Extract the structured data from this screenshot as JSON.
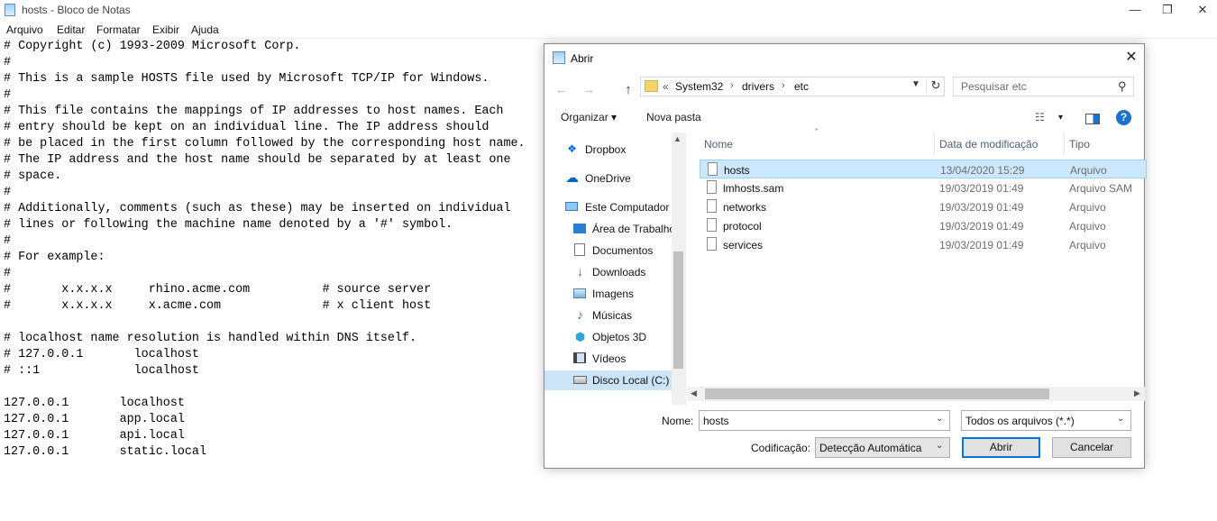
{
  "notepad": {
    "title": "hosts - Bloco de Notas",
    "window_controls": {
      "minimize": "—",
      "maximize": "❐",
      "close": "✕"
    },
    "menu": [
      "Arquivo",
      "Editar",
      "Formatar",
      "Exibir",
      "Ajuda"
    ],
    "content": "# Copyright (c) 1993-2009 Microsoft Corp.\n#\n# This is a sample HOSTS file used by Microsoft TCP/IP for Windows.\n#\n# This file contains the mappings of IP addresses to host names. Each\n# entry should be kept on an individual line. The IP address should\n# be placed in the first column followed by the corresponding host name.\n# The IP address and the host name should be separated by at least one\n# space.\n#\n# Additionally, comments (such as these) may be inserted on individual\n# lines or following the machine name denoted by a '#' symbol.\n#\n# For example:\n#\n#       x.x.x.x     rhino.acme.com          # source server\n#       x.x.x.x     x.acme.com              # x client host\n\n# localhost name resolution is handled within DNS itself.\n# 127.0.0.1       localhost\n# ::1             localhost\n\n127.0.0.1       localhost\n127.0.0.1       app.local\n127.0.0.1       api.local\n127.0.0.1       static.local"
  },
  "dialog": {
    "title": "Abrir",
    "close": "✕",
    "nav": {
      "back": "←",
      "forward": "→",
      "up": "↑"
    },
    "breadcrumb": {
      "prefix": "«",
      "parts": [
        "System32",
        "drivers",
        "etc"
      ],
      "sep": "›"
    },
    "search_placeholder": "Pesquisar etc",
    "toolbar": {
      "organize": "Organizar ▾",
      "new_folder": "Nova pasta",
      "view": "▾",
      "help": "?"
    },
    "sidebar": [
      {
        "label": "Dropbox",
        "icon": "dropbox-icon"
      },
      {
        "label": "OneDrive",
        "icon": "onedrive-icon"
      },
      {
        "label": "Este Computador",
        "icon": "computer-icon"
      },
      {
        "label": "Área de Trabalho",
        "icon": "desktop-icon"
      },
      {
        "label": "Documentos",
        "icon": "documents-icon"
      },
      {
        "label": "Downloads",
        "icon": "downloads-icon"
      },
      {
        "label": "Imagens",
        "icon": "pictures-icon"
      },
      {
        "label": "Músicas",
        "icon": "music-icon"
      },
      {
        "label": "Objetos 3D",
        "icon": "objects-3d-icon"
      },
      {
        "label": "Vídeos",
        "icon": "videos-icon"
      },
      {
        "label": "Disco Local (C:)",
        "icon": "drive-icon",
        "selected": true
      }
    ],
    "columns": {
      "name": "Nome",
      "date": "Data de modificação",
      "type": "Tipo"
    },
    "files": [
      {
        "name": "hosts",
        "date": "13/04/2020 15:29",
        "type": "Arquivo",
        "selected": true
      },
      {
        "name": "lmhosts.sam",
        "date": "19/03/2019 01:49",
        "type": "Arquivo SAM"
      },
      {
        "name": "networks",
        "date": "19/03/2019 01:49",
        "type": "Arquivo"
      },
      {
        "name": "protocol",
        "date": "19/03/2019 01:49",
        "type": "Arquivo"
      },
      {
        "name": "services",
        "date": "19/03/2019 01:49",
        "type": "Arquivo"
      }
    ],
    "name_label": "Nome:",
    "name_value": "hosts",
    "filter": "Todos os arquivos (*.*)",
    "encoding_label": "Codificação:",
    "encoding_value": "Detecção Automática",
    "open_button": "Abrir",
    "cancel_button": "Cancelar"
  }
}
